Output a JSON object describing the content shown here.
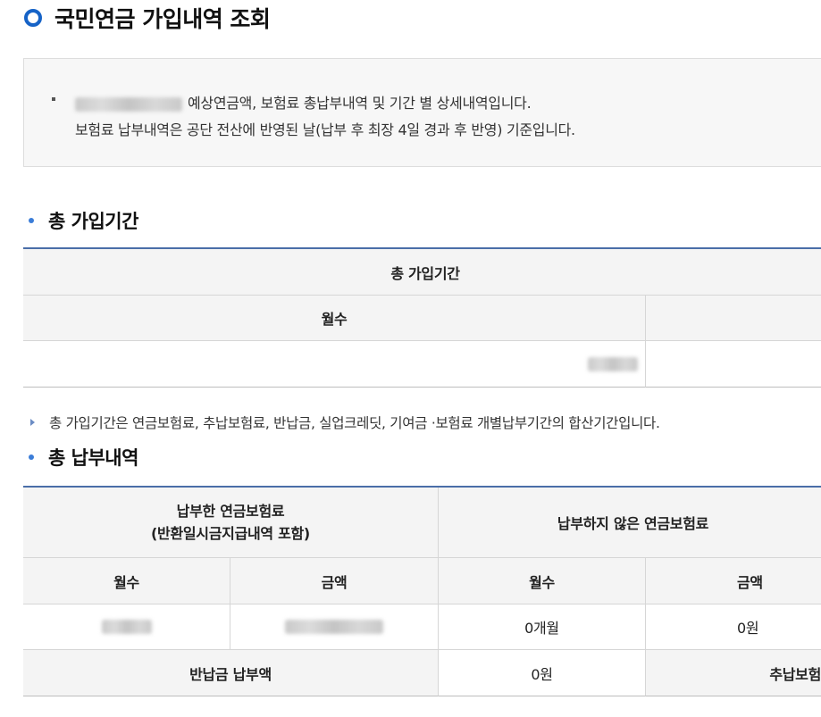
{
  "page": {
    "title": "국민연금 가입내역 조회"
  },
  "info": {
    "line1": "예상연금액, 보험료 총납부내역 및 기간 별 상세내역입니다.",
    "line2": "보험료 납부내역은 공단 전산에 반영된 날(납부 후 최장 4일 경과 후 반영) 기준입니다."
  },
  "section1": {
    "title": "총 가입기간",
    "header": "총 가입기간",
    "col_months": "월수",
    "note": "총 가입기간은 연금보험료, 추납보험료, 반납금, 실업크레딧, 기여금 ·보험료 개별납부기간의 합산기간입니다."
  },
  "section2": {
    "title": "총 납부내역",
    "paid_header_line1": "납부한 연금보험료",
    "paid_header_line2": "(반환일시금지급내역 포함)",
    "unpaid_header": "납부하지 않은 연금보험료",
    "col_months": "월수",
    "col_amount": "금액",
    "unpaid_months_value": "0개월",
    "unpaid_amount_value": "0원",
    "refund_label": "반납금 납부액",
    "refund_value": "0원",
    "extra_label": "추납보험"
  },
  "colors": {
    "accent": "#1663c7",
    "rule": "#4a6ea8",
    "header_bg": "#f4f4f4"
  }
}
